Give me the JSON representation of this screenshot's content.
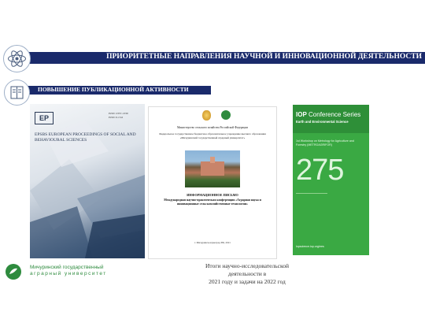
{
  "header": {
    "title": "ПРИОРИТЕТНЫЕ НАПРАВЛЕНИЯ НАУЧНОЙ И ИННОВАЦИОННОЙ ДЕЯТЕЛЬНОСТИ",
    "subtitle": "ПОВЫШЕНИЕ ПУБЛИКАЦИОННОЙ АКТИВНОСТИ",
    "icon1": "atom-icon",
    "icon2": "book-icon"
  },
  "cover_epsbs": {
    "logo": "EP",
    "issn_line1": "ISSN: 2357-1330",
    "issn_line2": "ISSN: 0.15.6",
    "title": "EPSBS EUROPEAN PROCEEDINGS OF SOCIAL AND BEHAVIOURAL SCIENCES"
  },
  "cover_letter": {
    "ministry": "Министерство сельского хозяйства Российской Федерации",
    "institution": "Федеральное государственное бюджетное образовательное учреждение высшего образования «Мичуринский государственный аграрный университет»",
    "doc_title": "ИНФОРМАЦИОННОЕ ПИСЬМО",
    "conference": "Международная научно-практическая конференция «Аграрная наука и инновационные сельскохозяйственные технологии»",
    "footer": "г. Мичуринск-наукоград РФ, 2021"
  },
  "cover_iop": {
    "brand": "IOP",
    "series": "Conference Series",
    "subject": "Earth and Environmental Science",
    "workshop": "1st Workshop on Metrology for Agriculture and Forestry (METROAGRIFOR)",
    "number": "275",
    "footer": "iopscience.iop.org/ees"
  },
  "footer": {
    "university_line1": "Мичуринский государственный",
    "university_line2": "аграрный университет",
    "caption_line1": "Итоги научно-исследовательской деятельности в",
    "caption_line2": "2021 году и задачи на 2022 год"
  },
  "colors": {
    "navy": "#1a2a6b",
    "iop_green": "#3aa943",
    "university_green": "#2e8b3e"
  }
}
